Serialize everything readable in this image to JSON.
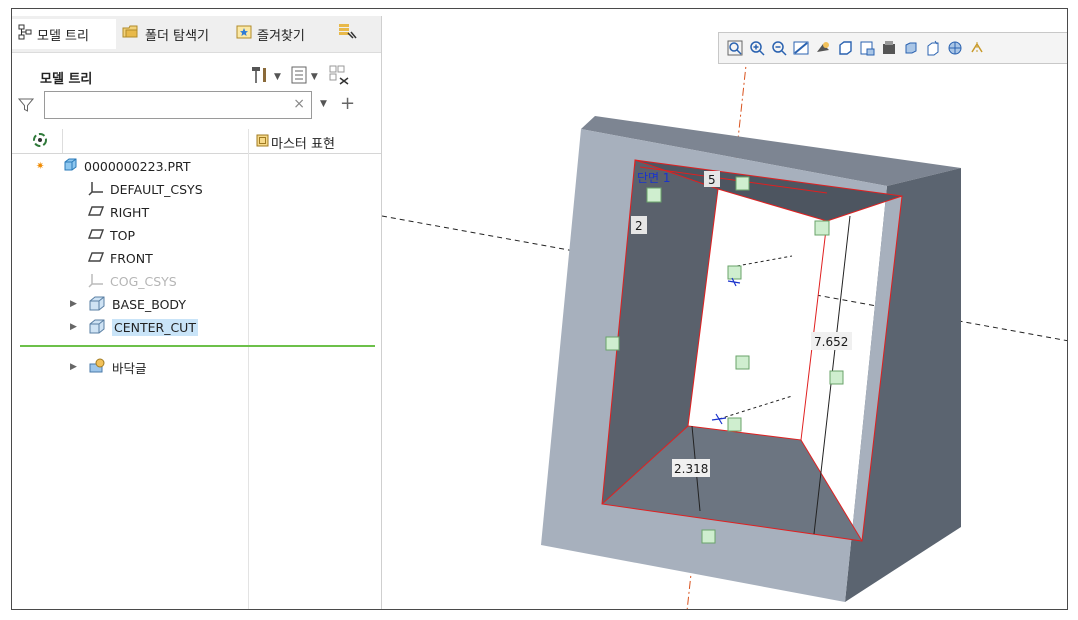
{
  "tabs": [
    {
      "label": "모델 트리",
      "icon": "model-tree-icon",
      "active": true
    },
    {
      "label": "폴더 탐색기",
      "icon": "folder-browser-icon",
      "active": false
    },
    {
      "label": "즐겨찾기",
      "icon": "favorites-icon",
      "active": false
    }
  ],
  "model_tree": {
    "title": "모델 트리",
    "search": {
      "value": "",
      "clear_glyph": "×"
    },
    "column_header": "마스터 표현",
    "items": [
      {
        "label": "0000000223.PRT",
        "icon": "part-icon"
      },
      {
        "label": "DEFAULT_CSYS",
        "icon": "csys-icon"
      },
      {
        "label": "RIGHT",
        "icon": "datum-plane-icon"
      },
      {
        "label": "TOP",
        "icon": "datum-plane-icon"
      },
      {
        "label": "FRONT",
        "icon": "datum-plane-icon"
      },
      {
        "label": "COG_CSYS",
        "icon": "csys-icon",
        "suppressed": true
      },
      {
        "label": "BASE_BODY",
        "icon": "extrude-icon"
      },
      {
        "label": "CENTER_CUT",
        "icon": "extrude-icon",
        "selected": true
      },
      {
        "label": "바닥글",
        "icon": "footer-icon"
      }
    ]
  },
  "viewport": {
    "section_label": "단면 1",
    "dims": {
      "width": "5",
      "depth": "2",
      "height": "7.652",
      "offset": "2.318"
    }
  },
  "colors": {
    "selection": "#c9e4f8",
    "separator": "#6cc04a",
    "body_front": "#a7b0bd",
    "body_top": "#7d8592",
    "body_side": "#5b6470",
    "edge_highlight": "#e02020",
    "dimension_text": "#1a1a1a",
    "section_text": "#1a33cc"
  }
}
